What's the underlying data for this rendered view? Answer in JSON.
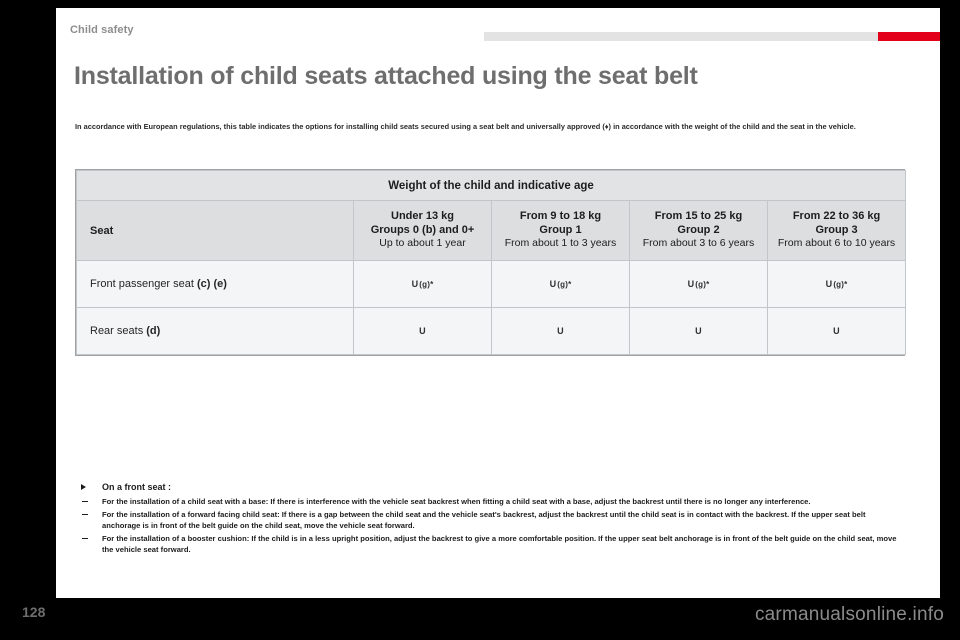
{
  "header": {
    "section_label": "Child safety",
    "accent_color": "#e2001a"
  },
  "title": "Installation of child seats attached using the seat belt",
  "intro": "In accordance with European regulations, this table indicates the options for installing child seats secured using a seat belt and universally approved (♦) in accordance with the weight of the child and the seat in the vehicle.",
  "table": {
    "banner": "Weight of the child and indicative age",
    "seat_column_header": "Seat",
    "groups": [
      {
        "weight": "Under 13 kg",
        "group": "Groups 0 (b) and 0+",
        "age": "Up to about 1 year"
      },
      {
        "weight": "From 9 to 18 kg",
        "group": "Group 1",
        "age": "From about 1 to 3 years"
      },
      {
        "weight": "From 15 to 25 kg",
        "group": "Group 2",
        "age": "From about 3 to 6 years"
      },
      {
        "weight": "From 22 to 36 kg",
        "group": "Group 3",
        "age": "From about 6 to 10 years"
      }
    ],
    "rows": [
      {
        "label": "Front passenger seat",
        "label_refs": "(c) (e)",
        "cells": [
          {
            "value": "U",
            "note": "(g)*"
          },
          {
            "value": "U",
            "note": "(g)*"
          },
          {
            "value": "U",
            "note": "(g)*"
          },
          {
            "value": "U",
            "note": "(g)*"
          }
        ]
      },
      {
        "label": "Rear seats",
        "label_refs": "(d)",
        "cells": [
          {
            "value": "U",
            "note": ""
          },
          {
            "value": "U",
            "note": ""
          },
          {
            "value": "U",
            "note": ""
          },
          {
            "value": "U",
            "note": ""
          }
        ]
      }
    ]
  },
  "notes": {
    "heading": "On a front seat :",
    "items": [
      "For the installation of a child seat with a base: If there is interference with the vehicle seat backrest when fitting a child seat with a base, adjust the backrest until there is no longer any interference.",
      "For the installation of a forward facing child seat: If there is a gap between the child seat and the vehicle seat's backrest, adjust the backrest until the child seat is in contact with the backrest. If the upper seat belt anchorage is in front of the belt guide on the child seat, move the vehicle seat forward.",
      "For the installation of a booster cushion: If the child is in a less upright position, adjust the backrest to give a more comfortable position. If the upper seat belt anchorage is in front of the belt guide on the child seat, move the vehicle seat forward."
    ]
  },
  "page_number": "128",
  "watermark": "carmanualsonline.info"
}
